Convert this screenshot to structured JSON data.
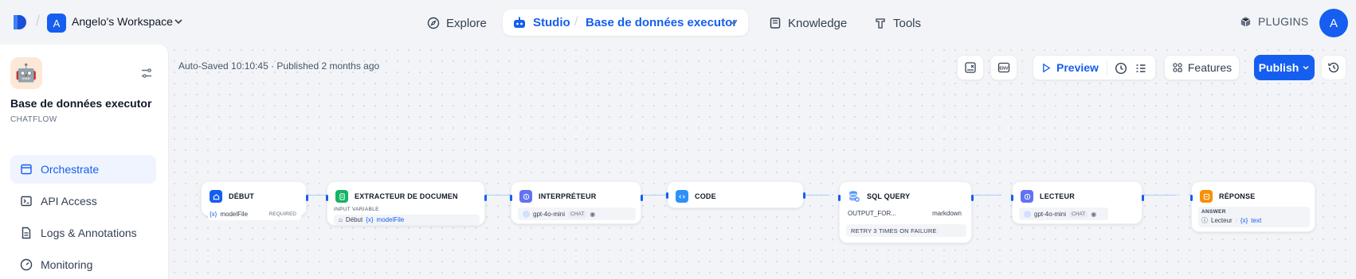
{
  "topbar": {
    "workspace_initial": "A",
    "workspace_name": "Angelo's Workspace",
    "nav": {
      "explore": "Explore",
      "studio": "Studio",
      "app_name": "Base de données executor",
      "knowledge": "Knowledge",
      "tools": "Tools"
    },
    "plugins_label": "PLUGINS",
    "user_initial": "A"
  },
  "sidebar": {
    "app_name": "Base de données executor",
    "app_type": "CHATFLOW",
    "items": [
      {
        "label": "Orchestrate"
      },
      {
        "label": "API Access"
      },
      {
        "label": "Logs & Annotations"
      },
      {
        "label": "Monitoring"
      }
    ]
  },
  "canvas": {
    "status": "Auto-Saved 10:10:45 · Published 2 months ago",
    "toolbar": {
      "preview_label": "Preview",
      "features_label": "Features",
      "publish_label": "Publish",
      "env_label": "ENV"
    },
    "nodes": {
      "debut": {
        "title": "DÉBUT",
        "var_name": "modelFile",
        "required": "REQUIRED"
      },
      "extracteur": {
        "title": "EXTRACTEUR DE DOCUMEN",
        "section_label": "INPUT VARIABLE",
        "source": "Début",
        "var_name": "modelFile"
      },
      "interpreteur": {
        "title": "INTERPRÉTEUR",
        "model": "gpt-4o-mini",
        "mode": "CHAT"
      },
      "code": {
        "title": "CODE"
      },
      "sql": {
        "title": "SQL QUERY",
        "output_name": "OUTPUT_FOR...",
        "output_format": "markdown",
        "retry": "RETRY 3 TIMES ON FAILURE"
      },
      "lecteur": {
        "title": "LECTEUR",
        "model": "gpt-4o-mini",
        "mode": "CHAT"
      },
      "reponse": {
        "title": "RÉPONSE",
        "section_label": "ANSWER",
        "source": "Lecteur",
        "var_name": "text"
      }
    },
    "var_token": "{x}"
  },
  "colors": {
    "accent": "#155eef",
    "start_node": "#155eef",
    "extractor_node": "#16b364",
    "llm_node": "#6172f3",
    "code_node": "#2e90fa",
    "answer_node": "#f79009"
  }
}
